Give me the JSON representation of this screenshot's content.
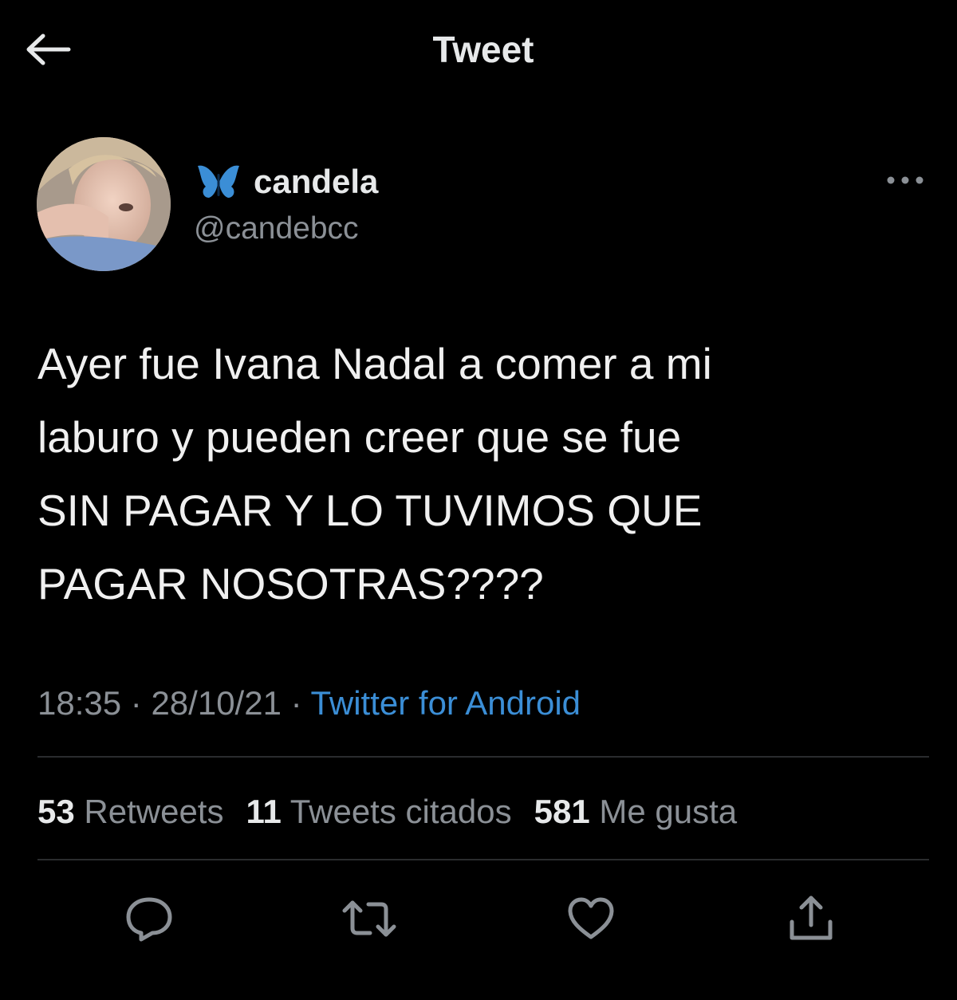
{
  "header": {
    "title": "Tweet",
    "back_icon": "arrow-left-icon"
  },
  "author": {
    "display_name": "candela",
    "handle": "@candebcc",
    "verified_icon": "butterfly-icon",
    "verified_color": "#3b8ed6"
  },
  "tweet": {
    "text": "Ayer fue Ivana Nadal a comer a mi\nlaburo y pueden creer que se fue\nSIN PAGAR Y LO TUVIMOS QUE\nPAGAR NOSOTRAS????",
    "time": "18:35",
    "date": "28/10/21",
    "separator": "·",
    "source": "Twitter for Android"
  },
  "stats": [
    {
      "count": "53",
      "label": "Retweets"
    },
    {
      "count": "11",
      "label": "Tweets citados"
    },
    {
      "count": "581",
      "label": "Me gusta"
    }
  ],
  "actions": [
    "reply-icon",
    "retweet-icon",
    "like-icon",
    "share-icon"
  ],
  "colors": {
    "background": "#000000",
    "text": "#e7e9ea",
    "muted": "#8b9096",
    "link": "#3b8ed6"
  }
}
